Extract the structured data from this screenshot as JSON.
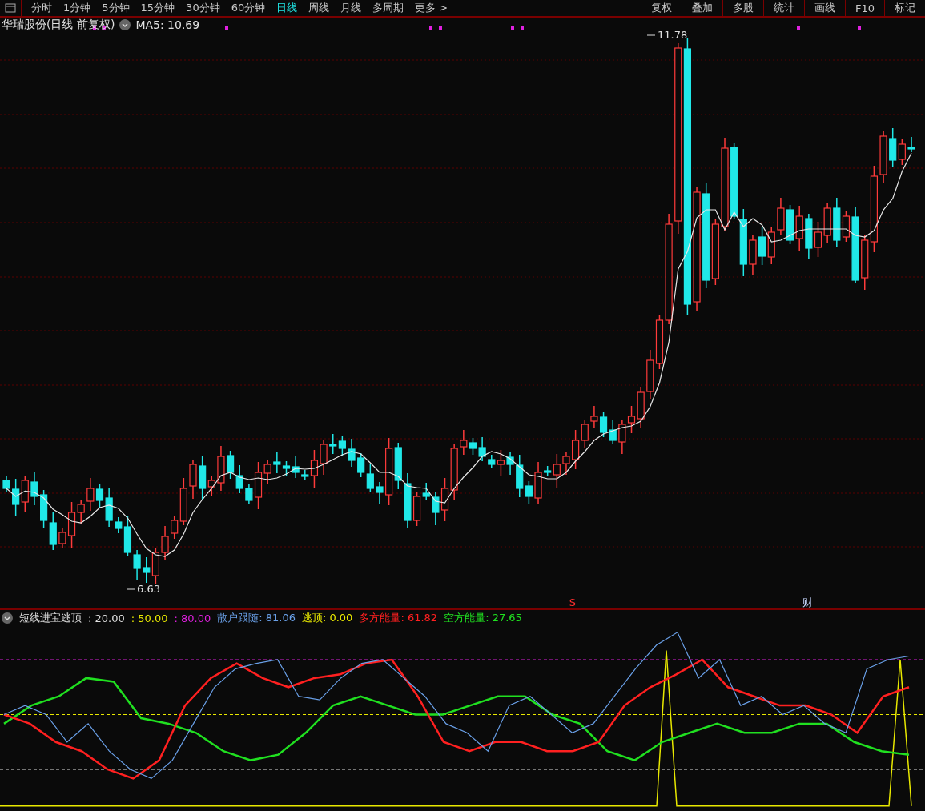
{
  "toolbar": {
    "periods": [
      {
        "label": "分时",
        "selected": false
      },
      {
        "label": "1分钟",
        "selected": false
      },
      {
        "label": "5分钟",
        "selected": false
      },
      {
        "label": "15分钟",
        "selected": false
      },
      {
        "label": "30分钟",
        "selected": false
      },
      {
        "label": "60分钟",
        "selected": false
      },
      {
        "label": "日线",
        "selected": true
      },
      {
        "label": "周线",
        "selected": false
      },
      {
        "label": "月线",
        "selected": false
      },
      {
        "label": "多周期",
        "selected": false
      },
      {
        "label": "更多 >",
        "selected": false
      }
    ],
    "tools": [
      "复权",
      "叠加",
      "多股",
      "统计",
      "画线",
      "F10",
      "标记"
    ]
  },
  "main_chart": {
    "title": "华瑞股份(日线 前复权)",
    "indicator": "MA5: 10.69",
    "high_label": "11.78",
    "low_label": "6.63",
    "markers": [
      {
        "text": "S",
        "color": "#ff3030"
      },
      {
        "text": "财",
        "color": "#c8d8ff"
      }
    ]
  },
  "sub_chart": {
    "name": "短线进宝逃顶",
    "items": [
      {
        "text": ": 20.00",
        "color": "#e0e0e0"
      },
      {
        "text": ": 50.00",
        "color": "#e8e800"
      },
      {
        "text": ": 80.00",
        "color": "#e020e0"
      },
      {
        "text": "散户跟随: 81.06",
        "color": "#6aa0e8"
      },
      {
        "text": "逃顶: 0.00",
        "color": "#e8e800"
      },
      {
        "text": "多方能量: 61.82",
        "color": "#ff2020"
      },
      {
        "text": "空方能量: 27.65",
        "color": "#20e020"
      }
    ]
  }
}
